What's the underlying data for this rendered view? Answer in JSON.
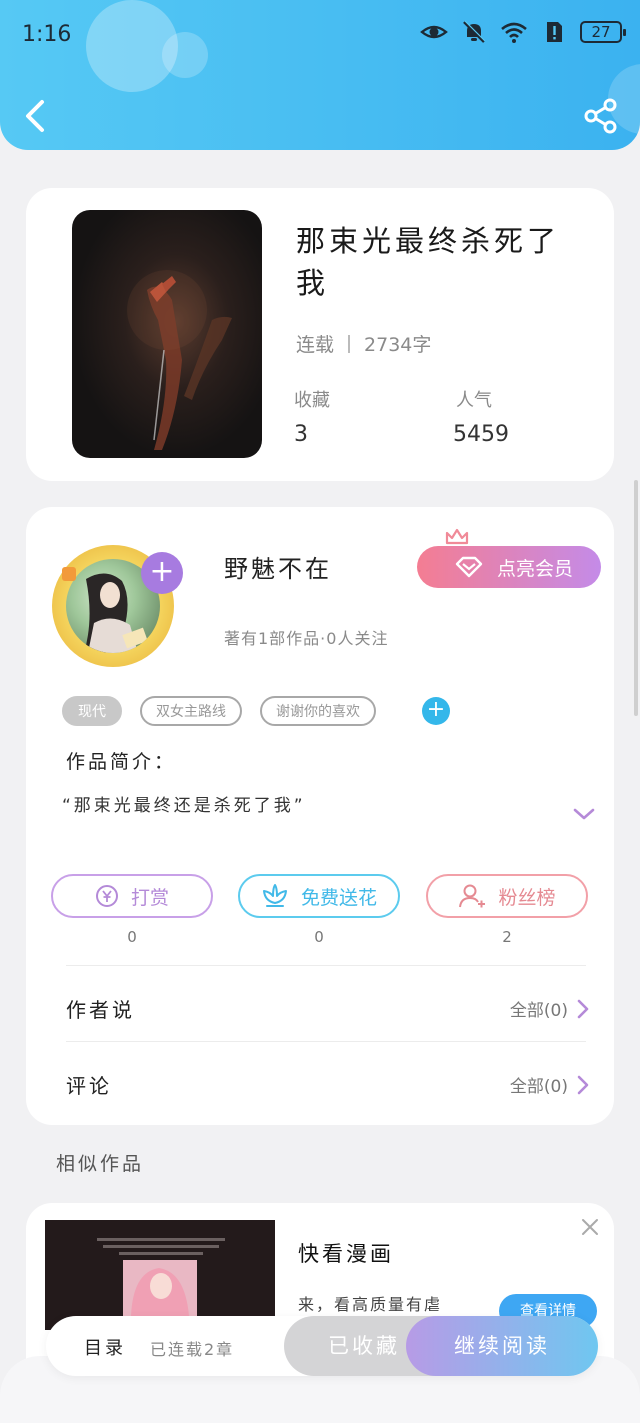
{
  "status_bar": {
    "time": "1:16",
    "battery": "27"
  },
  "header": {
    "back_icon": "chevron-left-icon",
    "share_icon": "share-icon"
  },
  "book": {
    "title": "那束光最终杀死了我",
    "status": "连载",
    "word_count": "2734字",
    "favorites_label": "收藏",
    "favorites_value": "3",
    "popularity_label": "人气",
    "popularity_value": "5459"
  },
  "author": {
    "name": "野魅不在",
    "sub": "著有1部作品·0人关注",
    "vip_label": "点亮会员",
    "follow_plus": "+"
  },
  "tags": [
    "现代",
    "双女主路线",
    "谢谢你的喜欢"
  ],
  "tag_add": "+",
  "intro": {
    "title": "作品简介：",
    "text": "“那束光最终还是杀死了我”"
  },
  "actions": [
    {
      "label": "打赏",
      "count": "0",
      "icon": "coin-icon"
    },
    {
      "label": "免费送花",
      "count": "0",
      "icon": "flower-icon"
    },
    {
      "label": "粉丝榜",
      "count": "2",
      "icon": "fans-icon"
    }
  ],
  "rows": [
    {
      "title": "作者说",
      "right": "全部(0)"
    },
    {
      "title": "评论",
      "right": "全部(0)"
    }
  ],
  "similar": {
    "title": "相似作品"
  },
  "ad": {
    "title": "快看漫画",
    "desc": "来，看高质量有虐",
    "detail_button": "查看详情"
  },
  "bottom_bar": {
    "catalog": "目录",
    "chapters": "已连载2章",
    "favorited": "已收藏",
    "continue": "继续阅读"
  },
  "colors": {
    "header_start": "#56c9f4",
    "header_end": "#3bb2f0",
    "vip_start": "#f47d92",
    "vip_end": "#c48be8",
    "accent_blue": "#34b7ea",
    "accent_purple": "#a77be0"
  }
}
